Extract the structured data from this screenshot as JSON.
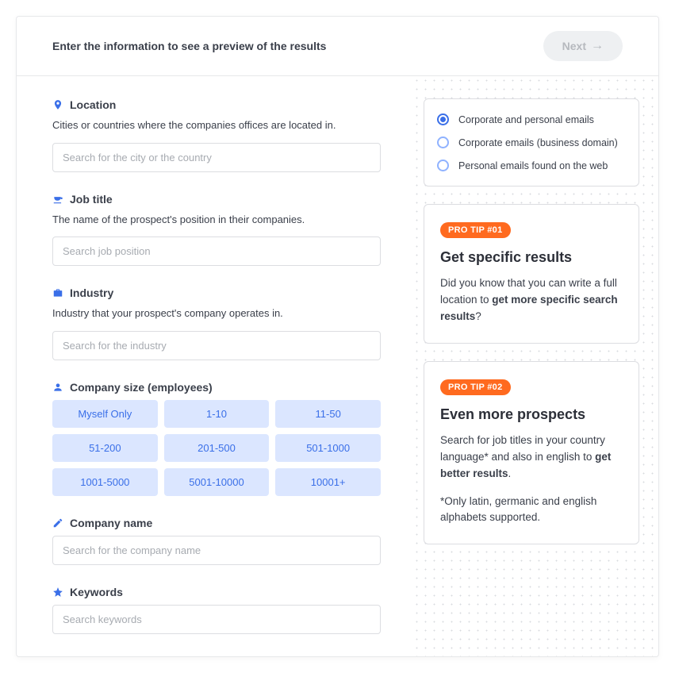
{
  "header": {
    "title": "Enter the information to see a preview of the results",
    "next_label": "Next"
  },
  "fields": {
    "location": {
      "label": "Location",
      "desc": "Cities or countries where the companies offices are located in.",
      "placeholder": "Search for the city or the country"
    },
    "job_title": {
      "label": "Job title",
      "desc": "The name of the prospect's position in their companies.",
      "placeholder": "Search job position"
    },
    "industry": {
      "label": "Industry",
      "desc": "Industry that your prospect's company operates in.",
      "placeholder": "Search for the industry"
    },
    "company_size": {
      "label": "Company size (employees)",
      "options": [
        "Myself Only",
        "1-10",
        "11-50",
        "51-200",
        "201-500",
        "501-1000",
        "1001-5000",
        "5001-10000",
        "10001+"
      ]
    },
    "company_name": {
      "label": "Company name",
      "placeholder": "Search for the company name"
    },
    "keywords": {
      "label": "Keywords",
      "placeholder": "Search keywords"
    }
  },
  "email_options": {
    "items": [
      {
        "label": "Corporate and personal emails",
        "checked": true
      },
      {
        "label": "Corporate emails (business domain)",
        "checked": false
      },
      {
        "label": "Personal emails found on the web",
        "checked": false
      }
    ]
  },
  "tips": [
    {
      "badge": "PRO TIP #01",
      "title": "Get specific results",
      "body_pre": "Did you know that you can write a full location to ",
      "body_bold": "get more specific search results",
      "body_post": "?",
      "footnote": ""
    },
    {
      "badge": "PRO TIP #02",
      "title": "Even more prospects",
      "body_pre": "Search for job titles in your country language* and also in english to ",
      "body_bold": "get better results",
      "body_post": ".",
      "footnote": "*Only latin, germanic and english alphabets supported."
    }
  ]
}
